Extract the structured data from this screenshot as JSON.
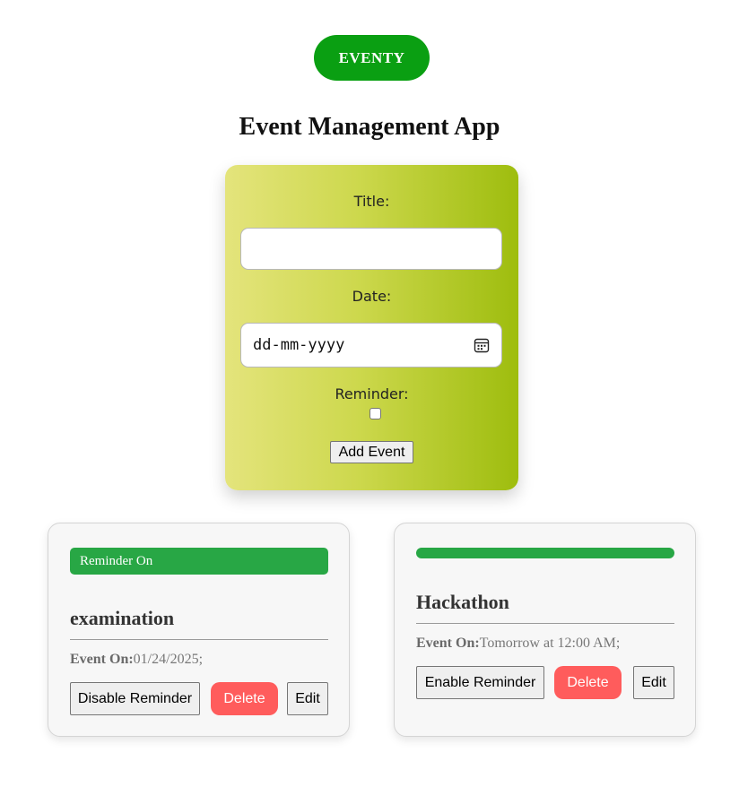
{
  "brand": {
    "label": "EVENTY",
    "color": "#0a9f12"
  },
  "page_title": "Event Management App",
  "form": {
    "title_label": "Title:",
    "title_value": "",
    "date_label": "Date:",
    "date_placeholder": "dd-mm-yyyy",
    "reminder_label": "Reminder:",
    "reminder_checked": false,
    "add_button_label": "Add Event",
    "gradient_colors": [
      "#e4e47c",
      "#9ebd0e"
    ]
  },
  "events": [
    {
      "reminder_on": true,
      "reminder_badge": "Reminder On",
      "title": "examination",
      "date_prefix": "Event On:",
      "date_value": "01/24/2025;",
      "toggle_label": "Disable Reminder",
      "delete_label": "Delete",
      "edit_label": "Edit"
    },
    {
      "reminder_on": false,
      "reminder_badge": "",
      "title": "Hackathon",
      "date_prefix": "Event On:",
      "date_value": "Tomorrow at 12:00 AM;",
      "toggle_label": "Enable Reminder",
      "delete_label": "Delete",
      "edit_label": "Edit"
    }
  ],
  "colors": {
    "reminder_green": "#28a745",
    "delete_red": "#ff5c5c",
    "card_background": "#f7f7f7"
  },
  "icons": {
    "date_picker": "calendar-icon"
  }
}
